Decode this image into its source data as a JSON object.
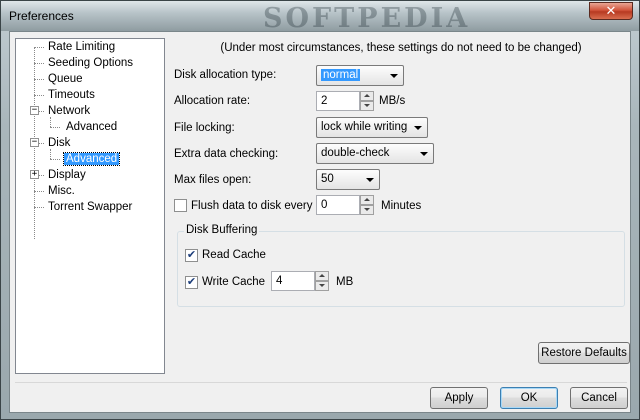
{
  "window": {
    "title": "Preferences",
    "watermark": "SOFTPEDIA",
    "close_glyph": "✕"
  },
  "tree": {
    "items": [
      {
        "label": "Rate Limiting"
      },
      {
        "label": "Seeding Options"
      },
      {
        "label": "Queue"
      },
      {
        "label": "Timeouts"
      },
      {
        "label": "Network",
        "expander": "−"
      },
      {
        "label": "Advanced"
      },
      {
        "label": "Disk",
        "expander": "−"
      },
      {
        "label": "Advanced",
        "selected": true
      },
      {
        "label": "Display",
        "expander": "+"
      },
      {
        "label": "Misc."
      },
      {
        "label": "Torrent Swapper"
      }
    ]
  },
  "panel": {
    "note": "(Under most circumstances, these settings do not need to be changed)",
    "allocation_type": {
      "label": "Disk allocation type:",
      "value": "normal"
    },
    "allocation_rate": {
      "label": "Allocation rate:",
      "value": "2",
      "unit": "MB/s"
    },
    "file_locking": {
      "label": "File locking:",
      "value": "lock while writing"
    },
    "extra_checking": {
      "label": "Extra data checking:",
      "value": "double-check"
    },
    "max_files": {
      "label": "Max files open:",
      "value": "50"
    },
    "flush": {
      "label": "Flush data to disk every",
      "value": "0",
      "unit": "Minutes",
      "checked": false
    },
    "buffering": {
      "title": "Disk Buffering",
      "read_cache": {
        "label": "Read Cache",
        "checked": true
      },
      "write_cache": {
        "label": "Write Cache",
        "checked": true,
        "value": "4",
        "unit": "MB"
      }
    },
    "check_glyph": "✔"
  },
  "buttons": {
    "restore": "Restore Defaults",
    "apply": "Apply",
    "ok": "OK",
    "cancel": "Cancel"
  }
}
